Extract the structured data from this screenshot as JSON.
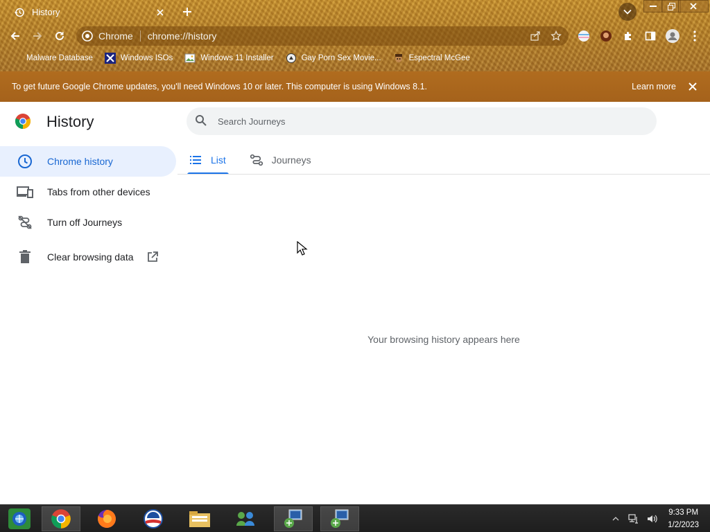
{
  "browser": {
    "tab": {
      "title": "History"
    },
    "omnibox": {
      "site_name": "Chrome",
      "url": "chrome://history"
    },
    "bookmarks": [
      {
        "label": "Malware Database",
        "icon": "none"
      },
      {
        "label": "Windows ISOs",
        "icon": "x-logo-icon"
      },
      {
        "label": "Windows 11 Installer",
        "icon": "image-icon"
      },
      {
        "label": "Gay Porn Sex Movie...",
        "icon": "site-favicon-icon"
      },
      {
        "label": "Espectral McGee",
        "icon": "avatar-favicon-icon"
      }
    ]
  },
  "infobar": {
    "message": "To get future Google Chrome updates, you'll need Windows 10 or later. This computer is using Windows 8.1.",
    "learn_more": "Learn more"
  },
  "page": {
    "title": "History",
    "search": {
      "placeholder": "Search Journeys"
    },
    "sidebar": [
      {
        "label": "Chrome history",
        "icon": "clock-icon",
        "active": true
      },
      {
        "label": "Tabs from other devices",
        "icon": "devices-icon",
        "active": false
      },
      {
        "label": "Turn off Journeys",
        "icon": "journeys-off-icon",
        "active": false
      },
      {
        "label": "Clear browsing data",
        "icon": "trash-icon",
        "active": false
      }
    ],
    "tabs": [
      {
        "label": "List",
        "icon": "list-icon",
        "active": true
      },
      {
        "label": "Journeys",
        "icon": "journeys-icon",
        "active": false
      }
    ],
    "empty_message": "Your browsing history appears here"
  },
  "taskbar": {
    "time": "9:33 PM",
    "date": "1/2/2023"
  },
  "colors": {
    "accent": "#1a73e8",
    "active_bg": "#e8f0fe",
    "infobar": "#a9661d",
    "taskbar": "#202020"
  }
}
